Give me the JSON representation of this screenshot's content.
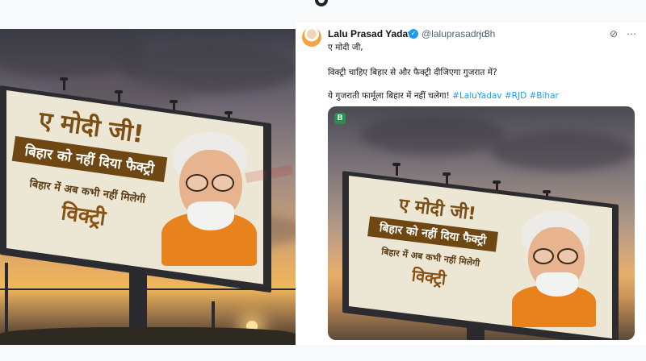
{
  "tweet": {
    "author_name": "Lalu Prasad Yadav",
    "handle": "@laluprasadrjd",
    "separator": "·",
    "time": "3h",
    "line1": "ए मोदी जी,",
    "line2": "विक्ट्री चाहिए बिहार से और फैक्ट्री दीजिएगा गुजरात में?",
    "line3_text": "ये गुजराती फार्मूला बिहार में नहीं चलेगा!",
    "hashtags": [
      "#LaluYadav",
      "#RJD",
      "#Bihar"
    ],
    "media_badge": "B"
  },
  "billboard": {
    "title": "ए मोदी जी!",
    "tag": "बिहार को नहीं दिया फैक्ट्री",
    "sub": "बिहार में अब कभी नहीं मिलेगी",
    "word": "विक्ट्री"
  },
  "icons": {
    "verified": "verified-check-icon",
    "grok": "grok-icon",
    "more": "more-options-icon"
  },
  "colors": {
    "hashtag": "#1d9bf0",
    "billboard_tag_bg": "#6e4712",
    "character_shirt": "#e8821d"
  }
}
